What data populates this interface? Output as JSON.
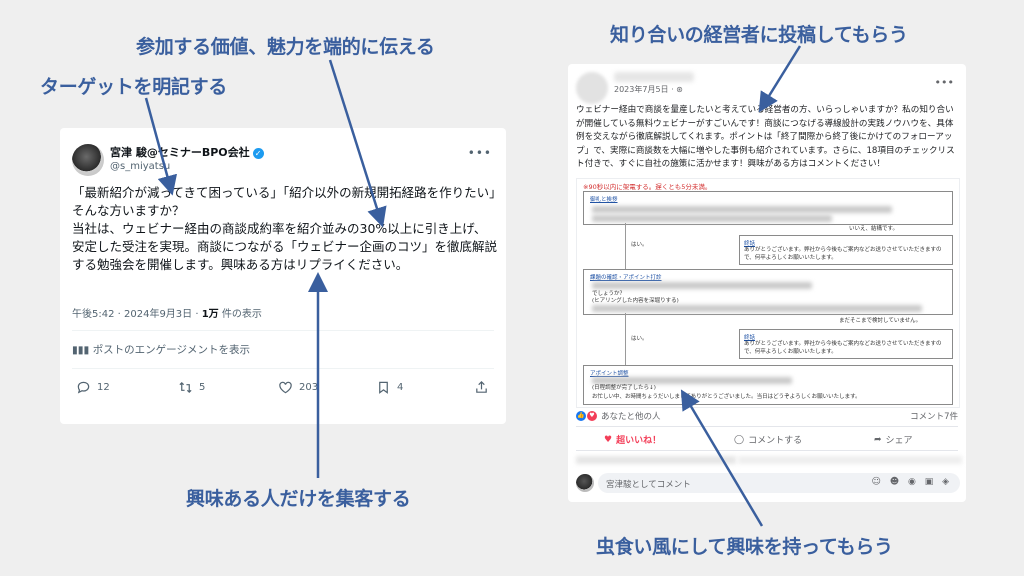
{
  "callouts": {
    "value": "参加する価値、魅力を端的に伝える",
    "target": "ターゲットを明記する",
    "interest": "興味ある人だけを集客する",
    "ask_owner": "知り合いの経営者に投稿してもらう",
    "wormhole": "虫食い風にして興味を持ってもらう"
  },
  "tweet": {
    "name": "宮津 駿@セミナーBPO会社",
    "handle": "@s_miyatsu",
    "body_lines": [
      "「最新紹介が減ってきて困っている」「紹介以外の新規開拓経路を作りたい」そんな方いますか？",
      "当社は、ウェビナー経由の商談成約率を紹介並みの30%以上に引き上げ、安定した受注を実現。商談につながる「ウェビナー企画のコツ」を徹底解説する勉強会を開催します。興味ある方はリプライください。"
    ],
    "meta_time": "午後5:42 · 2024年9月3日 · ",
    "meta_views": "1万",
    "meta_views_suffix": " 件の表示",
    "engagement_link": "ポストのエンゲージメントを表示",
    "replies": "12",
    "retweets": "5",
    "likes": "203",
    "bookmarks": "4"
  },
  "fb": {
    "date": "2023年7月5日 · ",
    "body": "ウェビナー経由で商談を量産したいと考えている経営者の方、いらっしゃいますか？私の知り合いが開催している無料ウェビナーがすごいんです！商談につなげる導線設計の実践ノウハウを、具体例を交えながら徹底解説してくれます。ポイントは「終了間際から終了後にかけてのフォローアップ」で、実際に商談数を大幅に増やした事例も紹介されています。さらに、18項目のチェックリスト付きで、すぐに自社の施策に活かせます！興味がある方はコメントください！",
    "image": {
      "red_note": "※90秒以内に架電する。遅くとも5分未満。",
      "box1_title": "御礼と挨拶",
      "no_label": "いいえ、結構です。",
      "yes1": "はい。",
      "end1_title": "終話",
      "end1_text": "ありがとうございます。弊社から今後もご案内などお送りさせていただきますので、何卒よろしくお願いいたします。",
      "box2_title": "課題の確認・アポイント打診",
      "box2_line": "でしょうか？",
      "box2_note": "(ヒアリングした内容を深堀りする)",
      "not_now": "まだそこまで検討していません。",
      "yes2": "はい。",
      "end2_title": "終話",
      "end2_text": "ありがとうございます。弊社から今後もご案内などお送りさせていただきますので、何卒よろしくお願いいたします。",
      "box3_title": "アポイント調整",
      "box3_note": "(日程調整が完了したら↓)",
      "box3_line": "お忙しい中、お時間ちょうだいしましてありがとうございました。当日はどうぞよろしくお願いいたします。"
    },
    "likes_text": "あなたと他の人",
    "comments_count": "コメント7件",
    "like_button": "超いいね！",
    "comment_button": "コメントする",
    "share_button": "シェア",
    "comment_placeholder": "宮津駿としてコメント"
  }
}
